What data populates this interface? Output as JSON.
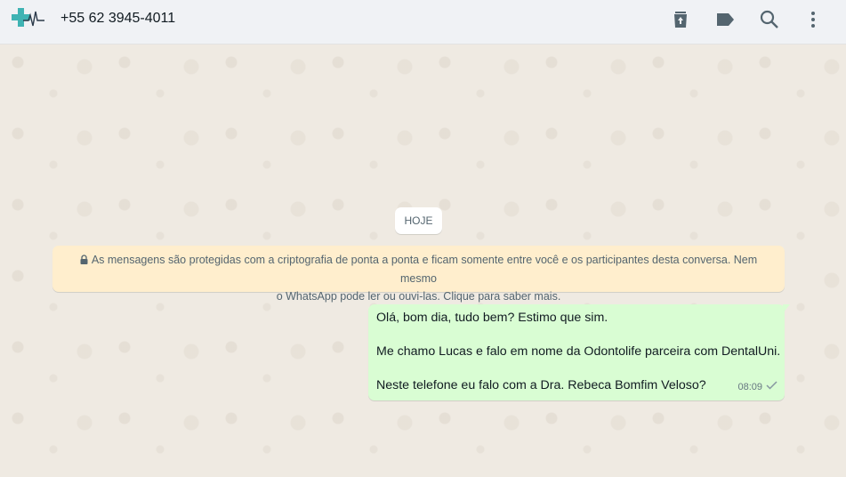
{
  "header": {
    "contact_name": "+55 62 3945-4011",
    "icons": [
      "delete-chat-icon",
      "label-icon",
      "search-icon",
      "menu-icon"
    ]
  },
  "chat": {
    "date_chip": "HOJE",
    "encryption_line1": "As mensagens são protegidas com a criptografia de ponta a ponta e ficam somente entre você e os participantes desta conversa. Nem mesmo",
    "encryption_line2": "o WhatsApp pode ler ou ouvi-las. Clique para saber mais.",
    "message": {
      "line1": "Olá, bom dia, tudo bem? Estimo que sim.",
      "line2": "Me chamo Lucas e falo em nome da Odontolife parceira com DentalUni.",
      "line3": "Neste telefone eu falo com a Dra. Rebeca Bomfim Veloso?",
      "time": "08:09",
      "status": "sent"
    }
  },
  "colors": {
    "accent": "#3fb3b3",
    "bubble_out": "#d9fdd3",
    "notice_bg": "#ffeecd"
  }
}
